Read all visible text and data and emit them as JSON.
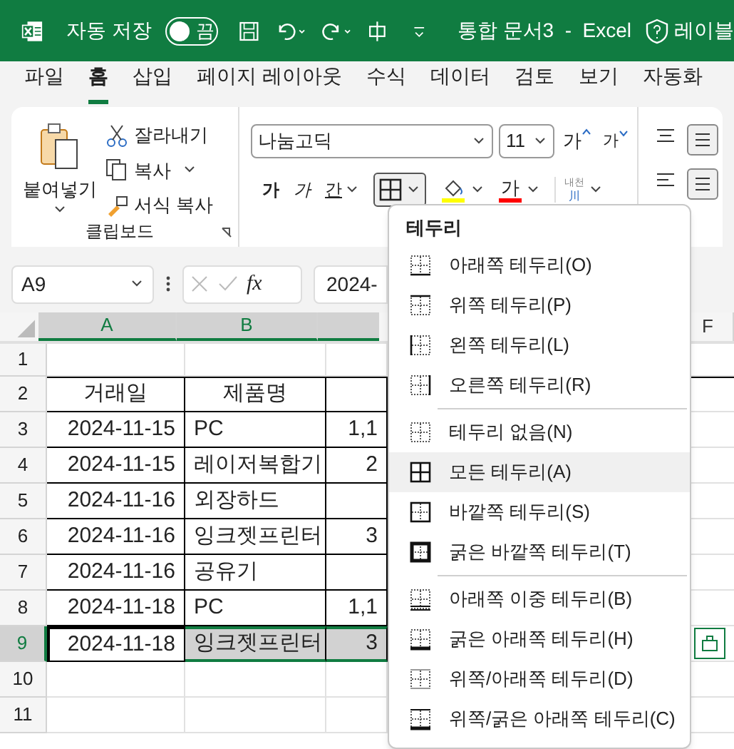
{
  "title_bar": {
    "autosave_label": "자동 저장",
    "autosave_toggle": {
      "on": false,
      "label": "끔"
    },
    "document_title": "통합 문서3  -  Excel",
    "label_button": "레이블"
  },
  "ribbon_tabs": [
    {
      "label": "파일",
      "selected": false
    },
    {
      "label": "홈",
      "selected": true
    },
    {
      "label": "삽입",
      "selected": false
    },
    {
      "label": "페이지 레이아웃",
      "selected": false
    },
    {
      "label": "수식",
      "selected": false
    },
    {
      "label": "데이터",
      "selected": false
    },
    {
      "label": "검토",
      "selected": false
    },
    {
      "label": "보기",
      "selected": false
    },
    {
      "label": "자동화",
      "selected": false
    }
  ],
  "clipboard": {
    "paste": "붙여넣기",
    "cut": "잘라내기",
    "copy": "복사",
    "format_painter": "서식 복사",
    "group_label": "클립보드"
  },
  "font": {
    "name": "나눔고딕",
    "size": "11",
    "grow": "가",
    "shrink": "가",
    "bold": "가",
    "italic": "가",
    "underline": "간",
    "font_color": "가",
    "phonetic": "내천",
    "phonetic_sub": "川",
    "borders_pressed": true
  },
  "formula_bar": {
    "name_box": "A9",
    "fx": "fx",
    "value": "2024-"
  },
  "grid": {
    "columns": [
      {
        "label": "A",
        "selected": true
      },
      {
        "label": "B",
        "selected": true
      },
      {
        "label": "F",
        "selected": false
      }
    ],
    "rows": [
      {
        "header": "1",
        "bordered": false,
        "cells": []
      },
      {
        "header": "2",
        "bordered": true,
        "cells": [
          {
            "text": "거래일",
            "selected": false
          },
          {
            "text": "제품명",
            "selected": false
          },
          {
            "text": "",
            "selected": false
          }
        ]
      },
      {
        "header": "3",
        "bordered": true,
        "cells": [
          {
            "text": "2024-11-15",
            "selected": false
          },
          {
            "text": "PC",
            "selected": false
          },
          {
            "text": "1,1",
            "selected": false
          }
        ]
      },
      {
        "header": "4",
        "bordered": true,
        "cells": [
          {
            "text": "2024-11-15",
            "selected": false
          },
          {
            "text": "레이저복합기",
            "selected": false
          },
          {
            "text": "2",
            "selected": false
          }
        ]
      },
      {
        "header": "5",
        "bordered": true,
        "cells": [
          {
            "text": "2024-11-16",
            "selected": false
          },
          {
            "text": "외장하드",
            "selected": false
          },
          {
            "text": "",
            "selected": false
          }
        ]
      },
      {
        "header": "6",
        "bordered": true,
        "cells": [
          {
            "text": "2024-11-16",
            "selected": false
          },
          {
            "text": "잉크젯프린터",
            "selected": false
          },
          {
            "text": "3",
            "selected": false
          }
        ]
      },
      {
        "header": "7",
        "bordered": true,
        "cells": [
          {
            "text": "2024-11-16",
            "selected": false
          },
          {
            "text": "공유기",
            "selected": false
          },
          {
            "text": "",
            "selected": false
          }
        ]
      },
      {
        "header": "8",
        "bordered": true,
        "cells": [
          {
            "text": "2024-11-18",
            "selected": false
          },
          {
            "text": "PC",
            "selected": false
          },
          {
            "text": "1,1",
            "selected": false
          }
        ]
      },
      {
        "header": "9",
        "bordered": true,
        "cells": [
          {
            "text": "2024-11-18",
            "selected": true
          },
          {
            "text": "잉크젯프린터",
            "selected": true
          },
          {
            "text": "3",
            "selected": true
          }
        ]
      },
      {
        "header": "10",
        "bordered": false,
        "cells": []
      },
      {
        "header": "11",
        "bordered": false,
        "cells": []
      }
    ]
  },
  "border_menu": {
    "title": "테두리",
    "items": [
      {
        "kind": "bottom",
        "label": "아래쪽 테두리(O)",
        "hovered": false
      },
      {
        "kind": "top",
        "label": "위쪽 테두리(P)",
        "hovered": false
      },
      {
        "kind": "left",
        "label": "왼쪽 테두리(L)",
        "hovered": false
      },
      {
        "kind": "right",
        "label": "오른쪽 테두리(R)",
        "hovered": false
      },
      {
        "kind": "separator"
      },
      {
        "kind": "none",
        "label": "테두리 없음(N)",
        "hovered": false
      },
      {
        "kind": "all",
        "label": "모든 테두리(A)",
        "hovered": true
      },
      {
        "kind": "outside",
        "label": "바깥쪽 테두리(S)",
        "hovered": false
      },
      {
        "kind": "thick_outside",
        "label": "굵은 바깥쪽 테두리(T)",
        "hovered": false
      },
      {
        "kind": "separator"
      },
      {
        "kind": "double_bottom",
        "label": "아래쪽 이중 테두리(B)",
        "hovered": false
      },
      {
        "kind": "thick_bottom",
        "label": "굵은 아래쪽 테두리(H)",
        "hovered": false
      },
      {
        "kind": "top_bottom",
        "label": "위쪽/아래쪽 테두리(D)",
        "hovered": false
      },
      {
        "kind": "top_thick_bottom",
        "label": "위쪽/굵은 아래쪽 테두리(C)",
        "hovered": false
      }
    ]
  }
}
